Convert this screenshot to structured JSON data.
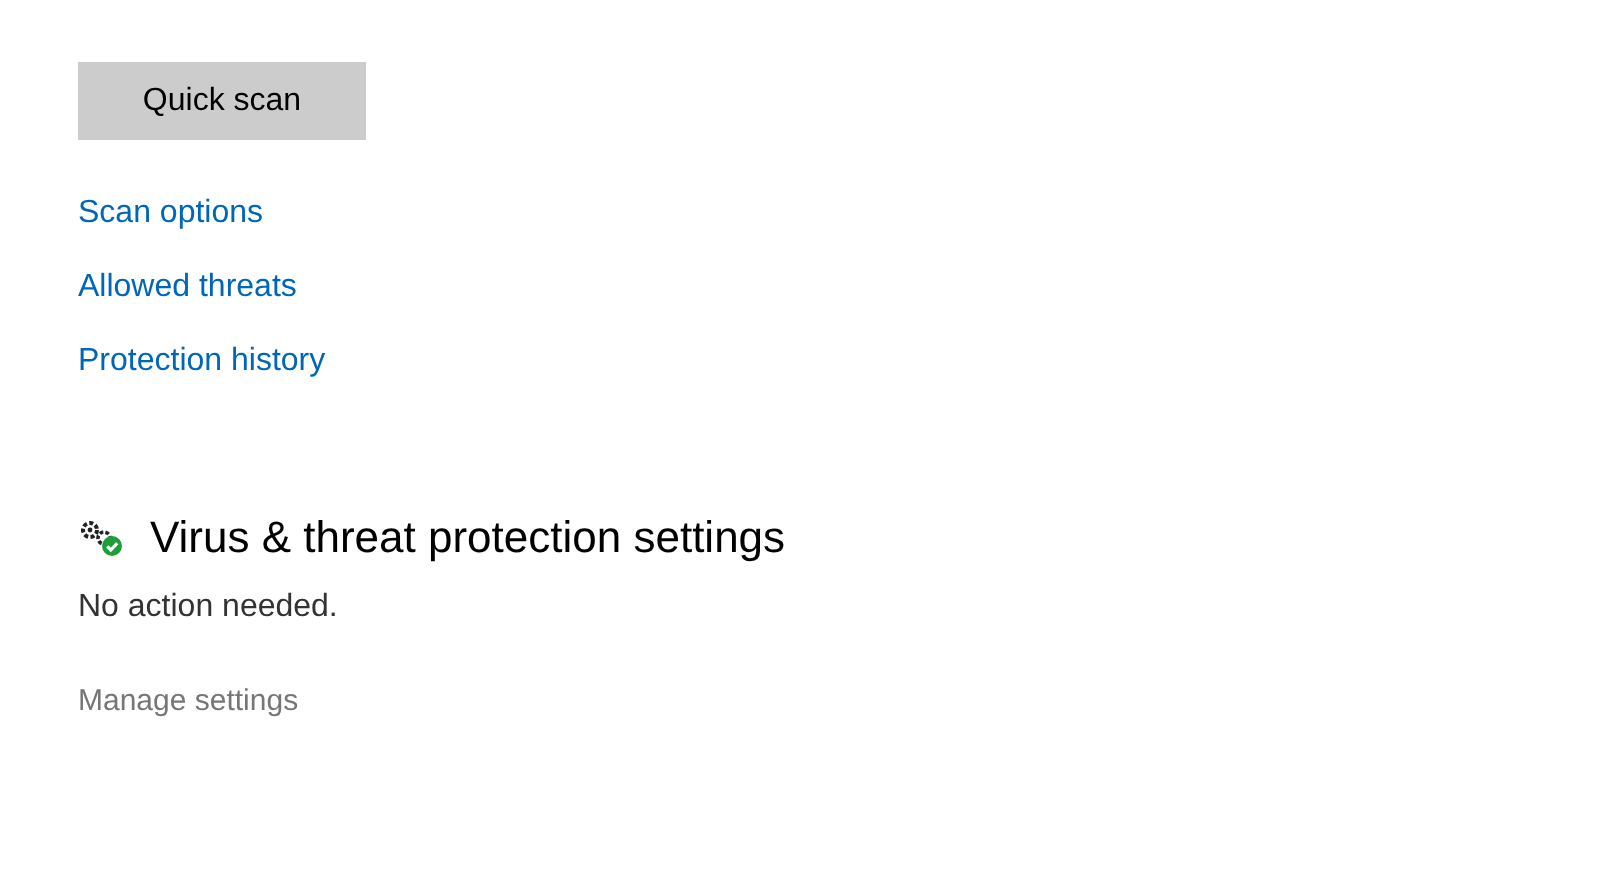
{
  "scan_button": {
    "label": "Quick scan"
  },
  "links": [
    {
      "label": "Scan options"
    },
    {
      "label": "Allowed threats"
    },
    {
      "label": "Protection history"
    }
  ],
  "settings_section": {
    "title": "Virus & threat protection settings",
    "status": "No action needed.",
    "manage_link": {
      "label": "Manage settings",
      "disabled": true
    }
  }
}
